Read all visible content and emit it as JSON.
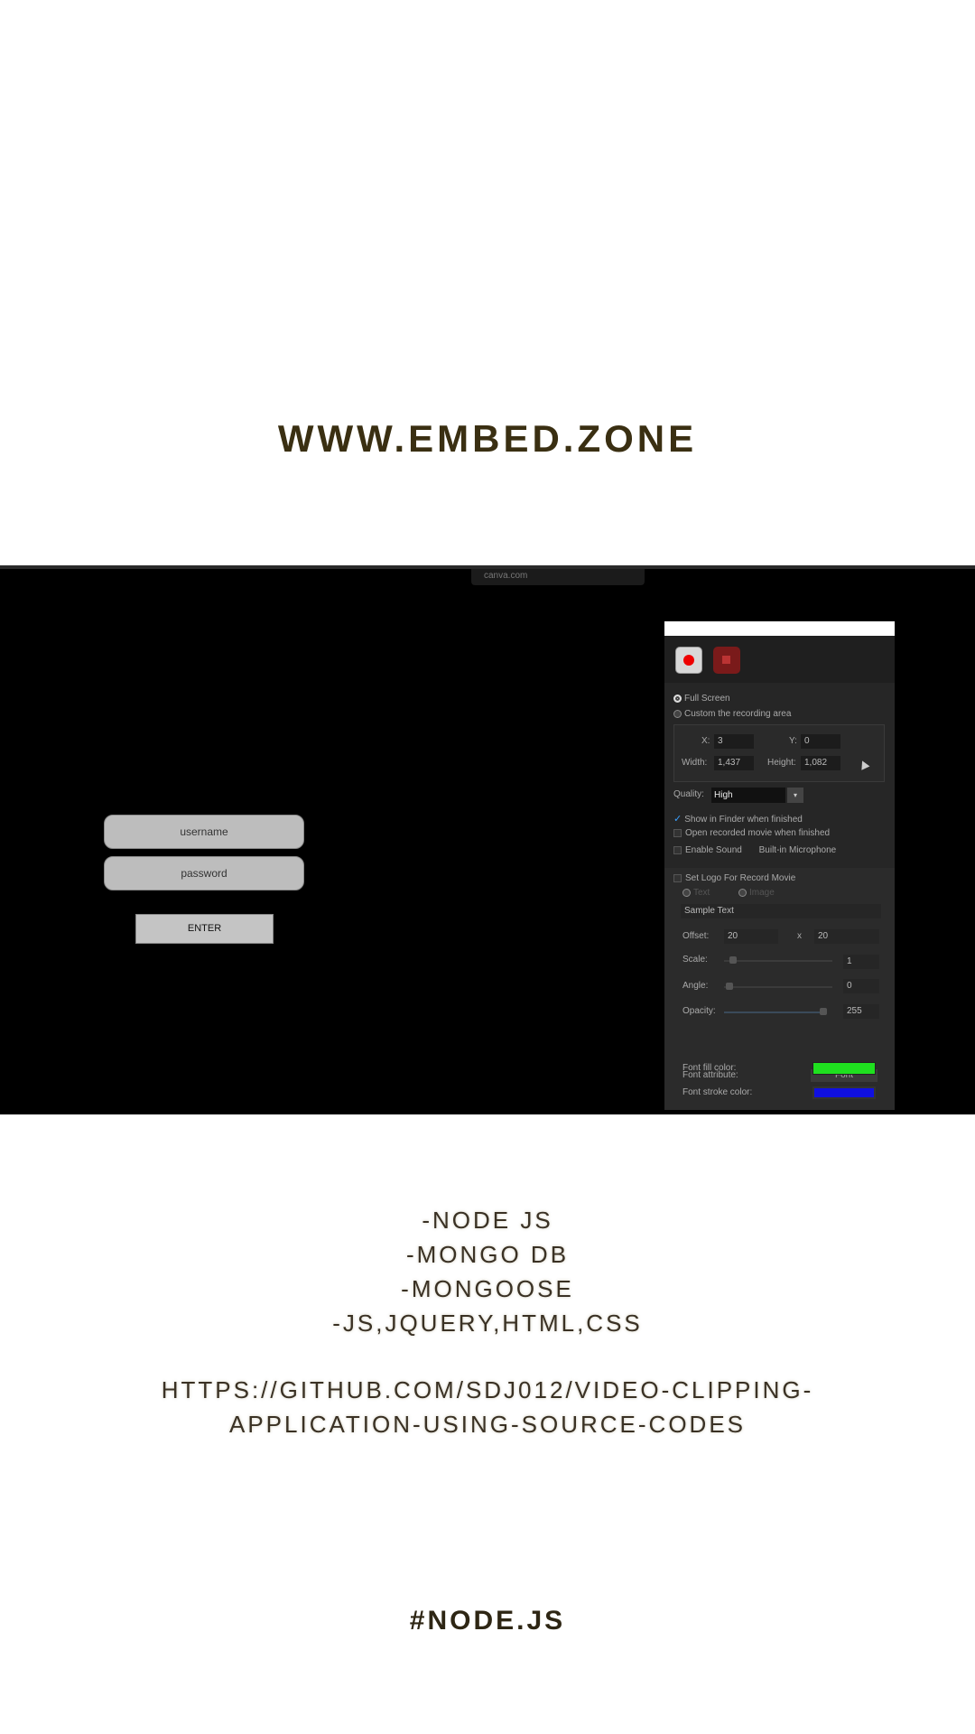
{
  "header": {
    "title": "WWW.EMBED.ZONE"
  },
  "screenshot": {
    "browser_url": "canva.com",
    "login": {
      "username_placeholder": "username",
      "password_placeholder": "password",
      "enter_label": "ENTER"
    },
    "recorder_panel": {
      "full_screen_label": "Full Screen",
      "custom_area_label": "Custom the recording area",
      "x_label": "X:",
      "x_value": "3",
      "y_label": "Y:",
      "y_value": "0",
      "width_label": "Width:",
      "width_value": "1,437",
      "height_label": "Height:",
      "height_value": "1,082",
      "quality_label": "Quality:",
      "quality_value": "High",
      "show_in_finder_label": "Show in Finder when finished",
      "open_movie_label": "Open recorded movie when finished",
      "enable_sound_label": "Enable Sound",
      "sound_source_value": "Built-in Microphone",
      "set_logo_label": "Set Logo For Record Movie",
      "logo_text_option": "Text",
      "logo_image_option": "Image",
      "sample_text_value": "Sample Text",
      "offset_label": "Offset:",
      "offset_x_value": "20",
      "offset_sep": "x",
      "offset_y_value": "20",
      "scale_label": "Scale:",
      "scale_value": "1",
      "angle_label": "Angle:",
      "angle_value": "0",
      "opacity_label": "Opacity:",
      "opacity_value": "255",
      "font_attribute_label": "Font attribute:",
      "font_button_label": "Font",
      "font_fill_label": "Font fill color:",
      "font_fill_color": "#1fe01f",
      "font_stroke_label": "Font stroke color:",
      "font_stroke_color": "#1010e0"
    }
  },
  "tech_list": [
    "-NODE JS",
    "-MONGO DB",
    "-MONGOOSE",
    "-JS,JQUERY,HTML,CSS"
  ],
  "repo_link": {
    "line1": "HTTPS://GITHUB.COM/SDJ012/VIDEO-CLIPPING-",
    "line2": "APPLICATION-USING-SOURCE-CODES"
  },
  "hashtag": "#NODE.JS",
  "colors": {
    "title_text": "#3a2f12",
    "background": "#ffffff",
    "screenshot_bg": "#000000"
  }
}
